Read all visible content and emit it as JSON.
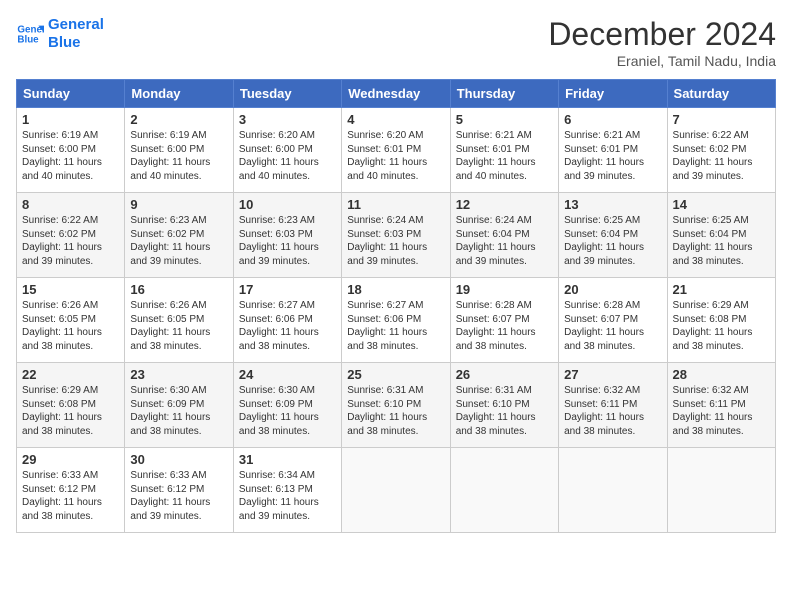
{
  "header": {
    "logo_line1": "General",
    "logo_line2": "Blue",
    "month_year": "December 2024",
    "location": "Eraniel, Tamil Nadu, India"
  },
  "weekdays": [
    "Sunday",
    "Monday",
    "Tuesday",
    "Wednesday",
    "Thursday",
    "Friday",
    "Saturday"
  ],
  "weeks": [
    [
      {
        "day": "1",
        "sunrise": "6:19 AM",
        "sunset": "6:00 PM",
        "daylight": "11 hours and 40 minutes."
      },
      {
        "day": "2",
        "sunrise": "6:19 AM",
        "sunset": "6:00 PM",
        "daylight": "11 hours and 40 minutes."
      },
      {
        "day": "3",
        "sunrise": "6:20 AM",
        "sunset": "6:00 PM",
        "daylight": "11 hours and 40 minutes."
      },
      {
        "day": "4",
        "sunrise": "6:20 AM",
        "sunset": "6:01 PM",
        "daylight": "11 hours and 40 minutes."
      },
      {
        "day": "5",
        "sunrise": "6:21 AM",
        "sunset": "6:01 PM",
        "daylight": "11 hours and 40 minutes."
      },
      {
        "day": "6",
        "sunrise": "6:21 AM",
        "sunset": "6:01 PM",
        "daylight": "11 hours and 39 minutes."
      },
      {
        "day": "7",
        "sunrise": "6:22 AM",
        "sunset": "6:02 PM",
        "daylight": "11 hours and 39 minutes."
      }
    ],
    [
      {
        "day": "8",
        "sunrise": "6:22 AM",
        "sunset": "6:02 PM",
        "daylight": "11 hours and 39 minutes."
      },
      {
        "day": "9",
        "sunrise": "6:23 AM",
        "sunset": "6:02 PM",
        "daylight": "11 hours and 39 minutes."
      },
      {
        "day": "10",
        "sunrise": "6:23 AM",
        "sunset": "6:03 PM",
        "daylight": "11 hours and 39 minutes."
      },
      {
        "day": "11",
        "sunrise": "6:24 AM",
        "sunset": "6:03 PM",
        "daylight": "11 hours and 39 minutes."
      },
      {
        "day": "12",
        "sunrise": "6:24 AM",
        "sunset": "6:04 PM",
        "daylight": "11 hours and 39 minutes."
      },
      {
        "day": "13",
        "sunrise": "6:25 AM",
        "sunset": "6:04 PM",
        "daylight": "11 hours and 39 minutes."
      },
      {
        "day": "14",
        "sunrise": "6:25 AM",
        "sunset": "6:04 PM",
        "daylight": "11 hours and 38 minutes."
      }
    ],
    [
      {
        "day": "15",
        "sunrise": "6:26 AM",
        "sunset": "6:05 PM",
        "daylight": "11 hours and 38 minutes."
      },
      {
        "day": "16",
        "sunrise": "6:26 AM",
        "sunset": "6:05 PM",
        "daylight": "11 hours and 38 minutes."
      },
      {
        "day": "17",
        "sunrise": "6:27 AM",
        "sunset": "6:06 PM",
        "daylight": "11 hours and 38 minutes."
      },
      {
        "day": "18",
        "sunrise": "6:27 AM",
        "sunset": "6:06 PM",
        "daylight": "11 hours and 38 minutes."
      },
      {
        "day": "19",
        "sunrise": "6:28 AM",
        "sunset": "6:07 PM",
        "daylight": "11 hours and 38 minutes."
      },
      {
        "day": "20",
        "sunrise": "6:28 AM",
        "sunset": "6:07 PM",
        "daylight": "11 hours and 38 minutes."
      },
      {
        "day": "21",
        "sunrise": "6:29 AM",
        "sunset": "6:08 PM",
        "daylight": "11 hours and 38 minutes."
      }
    ],
    [
      {
        "day": "22",
        "sunrise": "6:29 AM",
        "sunset": "6:08 PM",
        "daylight": "11 hours and 38 minutes."
      },
      {
        "day": "23",
        "sunrise": "6:30 AM",
        "sunset": "6:09 PM",
        "daylight": "11 hours and 38 minutes."
      },
      {
        "day": "24",
        "sunrise": "6:30 AM",
        "sunset": "6:09 PM",
        "daylight": "11 hours and 38 minutes."
      },
      {
        "day": "25",
        "sunrise": "6:31 AM",
        "sunset": "6:10 PM",
        "daylight": "11 hours and 38 minutes."
      },
      {
        "day": "26",
        "sunrise": "6:31 AM",
        "sunset": "6:10 PM",
        "daylight": "11 hours and 38 minutes."
      },
      {
        "day": "27",
        "sunrise": "6:32 AM",
        "sunset": "6:11 PM",
        "daylight": "11 hours and 38 minutes."
      },
      {
        "day": "28",
        "sunrise": "6:32 AM",
        "sunset": "6:11 PM",
        "daylight": "11 hours and 38 minutes."
      }
    ],
    [
      {
        "day": "29",
        "sunrise": "6:33 AM",
        "sunset": "6:12 PM",
        "daylight": "11 hours and 38 minutes."
      },
      {
        "day": "30",
        "sunrise": "6:33 AM",
        "sunset": "6:12 PM",
        "daylight": "11 hours and 39 minutes."
      },
      {
        "day": "31",
        "sunrise": "6:34 AM",
        "sunset": "6:13 PM",
        "daylight": "11 hours and 39 minutes."
      },
      null,
      null,
      null,
      null
    ]
  ]
}
